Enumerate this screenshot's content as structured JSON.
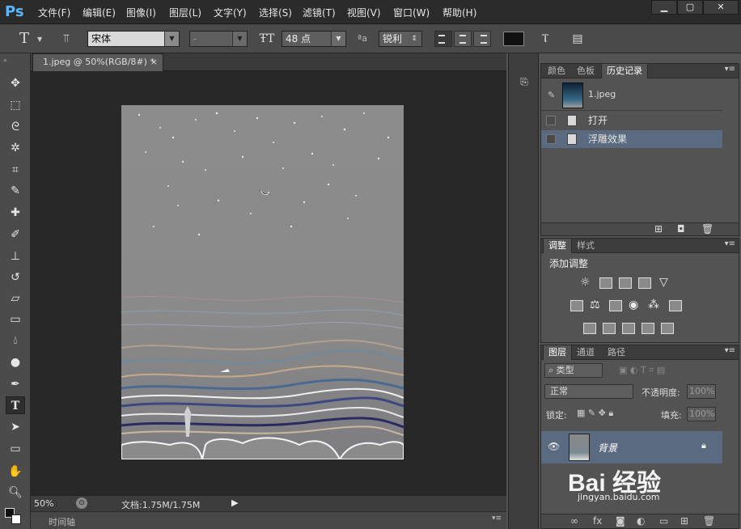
{
  "app": {
    "logo": "Ps"
  },
  "menu": [
    "文件(F)",
    "编辑(E)",
    "图像(I)",
    "图层(L)",
    "文字(Y)",
    "选择(S)",
    "滤镜(T)",
    "视图(V)",
    "窗口(W)",
    "帮助(H)"
  ],
  "window_controls": {
    "minimize": "▁",
    "maximize": "▢",
    "close": "✕"
  },
  "options": {
    "tool_glyph": "T",
    "font_family": "宋体",
    "font_style": "-",
    "font_size": "48 点",
    "aa_label": "ªa",
    "antialias": "锐利",
    "color_swatch": "#111111"
  },
  "document": {
    "tab_title": "1.jpeg @ 50%(RGB/8#) *",
    "tab_close": "×",
    "zoom": "50%",
    "doc_info": "文档:1.75M/1.75M",
    "timeline_label": "时间轴"
  },
  "tools": [
    "move-tool",
    "marquee-tool",
    "lasso-tool",
    "magic-wand-tool",
    "crop-tool",
    "eyedropper-tool",
    "healing-brush-tool",
    "brush-tool",
    "clone-stamp-tool",
    "history-brush-tool",
    "eraser-tool",
    "gradient-tool",
    "blur-tool",
    "dodge-tool",
    "pen-tool",
    "type-tool",
    "path-selection-tool",
    "rectangle-tool",
    "hand-tool",
    "zoom-tool"
  ],
  "history_panel": {
    "tabs": [
      "颜色",
      "色板",
      "历史记录"
    ],
    "snapshot_label": "1.jpeg",
    "items": [
      {
        "label": "打开",
        "selected": false
      },
      {
        "label": "浮雕效果",
        "selected": true
      }
    ]
  },
  "adjustments_panel": {
    "tabs": [
      "调整",
      "样式"
    ],
    "heading": "添加调整"
  },
  "layers_panel": {
    "tabs": [
      "图层",
      "通道",
      "路径"
    ],
    "filter_kind": "类型",
    "blend_mode": "正常",
    "opacity_label": "不透明度:",
    "opacity_value": "100%",
    "lock_label": "锁定:",
    "fill_label": "填充:",
    "fill_value": "100%",
    "layer_name": "背景"
  },
  "watermark": {
    "text": "Bai 经验",
    "sub": "jingyan.baidu.com"
  }
}
